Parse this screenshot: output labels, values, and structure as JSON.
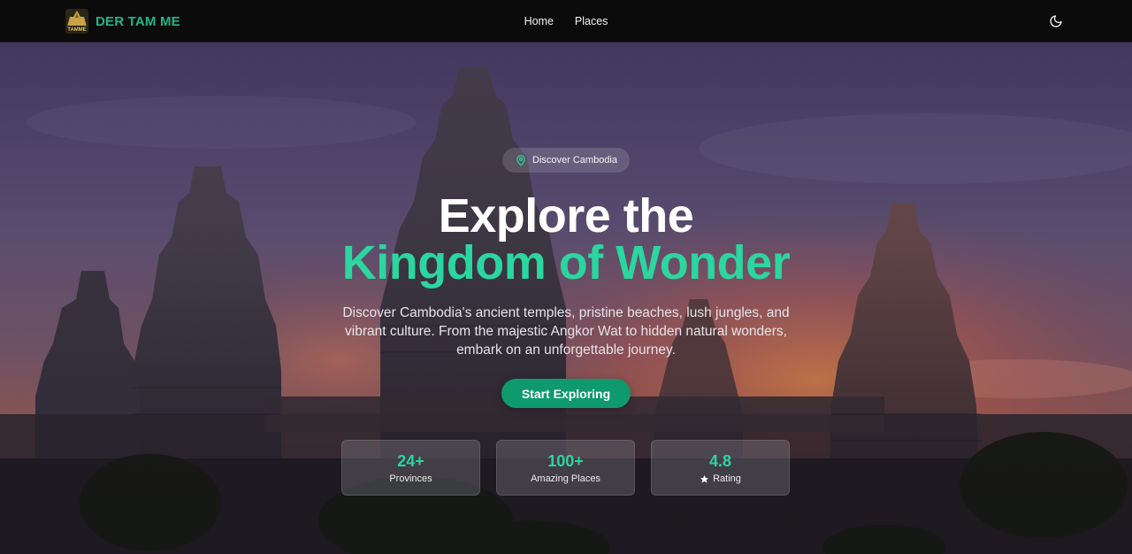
{
  "brand": {
    "name": "DER TAM ME",
    "logo_text": "TAMME",
    "logo_icon": "temple-logo-icon",
    "accent_color": "#1fb68a"
  },
  "nav": {
    "links": [
      {
        "label": "Home"
      },
      {
        "label": "Places"
      }
    ],
    "theme_toggle_icon": "moon-icon"
  },
  "hero": {
    "badge": {
      "label": "Discover Cambodia",
      "icon": "map-pin-icon"
    },
    "headline_line1": "Explore the",
    "headline_line2": "Kingdom of Wonder",
    "description": "Discover Cambodia's ancient temples, pristine beaches, lush jungles, and vibrant culture. From the majestic Angkor Wat to hidden natural wonders, embark on an unforgettable journey.",
    "cta_label": "Start Exploring",
    "cta_color": "#0e9a6c",
    "highlight_color": "#2bd69f",
    "background": "angkor-wat-sunset-image"
  },
  "stats": [
    {
      "value": "24+",
      "label": "Provinces"
    },
    {
      "value": "100+",
      "label": "Amazing Places"
    },
    {
      "value": "4.8",
      "label": "Rating",
      "icon": "star-icon"
    }
  ]
}
